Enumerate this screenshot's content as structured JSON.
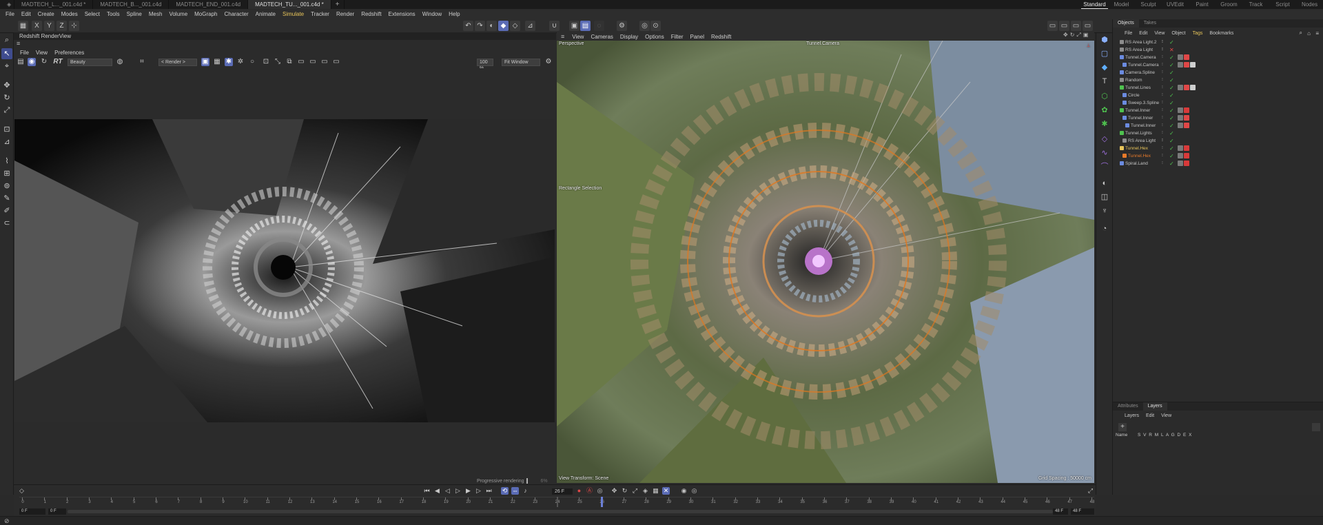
{
  "tabs": [
    "MADTECH_L..._001.c4d *",
    "MADTECH_B..._001.c4d",
    "MADTECH_END_001.c4d",
    "MADTECH_TU..._001.c4d *"
  ],
  "active_tab": 3,
  "new_tab": "+",
  "layouts": [
    "Standard",
    "Model",
    "Sculpt",
    "UVEdit",
    "Paint",
    "Groom",
    "Track",
    "Script",
    "Nodes"
  ],
  "menu": [
    "File",
    "Edit",
    "Create",
    "Modes",
    "Select",
    "Tools",
    "Spline",
    "Mesh",
    "Volume",
    "MoGraph",
    "Character",
    "Animate",
    "Simulate",
    "Tracker",
    "Render",
    "Redshift",
    "Extensions",
    "Window",
    "Help"
  ],
  "menu_highlight": "Simulate",
  "axis_labels": [
    "X",
    "Y",
    "Z"
  ],
  "renderview": {
    "title": "Redshift RenderView",
    "menu": [
      "File",
      "View",
      "Preferences"
    ],
    "rt": "RT",
    "aov": "Beauty",
    "render_target": "< Render >",
    "zoom": "100 %",
    "fit": "Fit Window",
    "progress_label": "Progressive rendering",
    "progress_pct": "6%"
  },
  "viewport": {
    "menu": [
      "View",
      "Cameras",
      "Display",
      "Options",
      "Filter",
      "Panel",
      "Redshift"
    ],
    "projection": "Perspective",
    "camera": "Tunnel.Camera",
    "selection": "Rectangle Selection",
    "view_transform": "View Transform: Scene",
    "grid_spacing": "Grid Spacing : 50000 cm"
  },
  "objects_panel": {
    "tabs": [
      "Objects",
      "Takes"
    ],
    "menu": [
      "File",
      "Edit",
      "View",
      "Object",
      "Tags",
      "Bookmarks"
    ],
    "items": [
      {
        "name": "RS Area Light.2",
        "indent": 1,
        "color": "#8c8c8c",
        "dot": "#e8e8e8",
        "status": "check",
        "highlight": false
      },
      {
        "name": "RS Area Light",
        "indent": 1,
        "color": "#8c8c8c",
        "dot": "#e8e8e8",
        "status": "cross",
        "highlight": false
      },
      {
        "name": "Tunnel.Camera",
        "indent": 1,
        "color": "#6b8be0",
        "dot": "#9c9c9c",
        "status": "check",
        "highlight": false
      },
      {
        "name": "Tunnel.Camera",
        "indent": 2,
        "color": "#6b8be0",
        "dot": "#9c9c9c",
        "status": "check",
        "highlight": false
      },
      {
        "name": "Camera.Spline",
        "indent": 1,
        "color": "#6b8be0",
        "dot": "#9c9c9c",
        "status": "check",
        "highlight": false
      },
      {
        "name": "Random",
        "indent": 1,
        "color": "#8c8c8c",
        "dot": "#9c9c9c",
        "status": "check",
        "highlight": false
      },
      {
        "name": "Tunnel.Lines",
        "indent": 1,
        "color": "#4fc24f",
        "dot": "#9c9c9c",
        "status": "check",
        "highlight": false
      },
      {
        "name": "Circle",
        "indent": 2,
        "color": "#6b8be0",
        "dot": "#9c9c9c",
        "status": "check",
        "highlight": false
      },
      {
        "name": "Sweep.3.Spline",
        "indent": 2,
        "color": "#6b8be0",
        "dot": "#9c9c9c",
        "status": "check",
        "highlight": false
      },
      {
        "name": "Tunnel.Inner",
        "indent": 1,
        "color": "#4fc24f",
        "dot": "#9c9c9c",
        "status": "check",
        "highlight": false
      },
      {
        "name": "Tunnel.Inner",
        "indent": 2,
        "color": "#6b8be0",
        "dot": "#9c9c9c",
        "status": "check",
        "highlight": false
      },
      {
        "name": "Tunnel.Inner",
        "indent": 3,
        "color": "#6b8be0",
        "dot": "#9c9c9c",
        "status": "check",
        "highlight": false
      },
      {
        "name": "Tunnel.Lights",
        "indent": 1,
        "color": "#4fc24f",
        "dot": "#9c9c9c",
        "status": "check",
        "highlight": false
      },
      {
        "name": "RS Area Light",
        "indent": 2,
        "color": "#8c8c8c",
        "dot": "#e8e8e8",
        "status": "check",
        "highlight": false
      },
      {
        "name": "Tunnel.Hex",
        "indent": 1,
        "color": "#e8c55a",
        "dot": "#9c9c9c",
        "status": "check",
        "highlight": true
      },
      {
        "name": "Tunnel.Hex",
        "indent": 2,
        "color": "#e87a2a",
        "dot": "#9c9c9c",
        "status": "check",
        "highlight": true
      },
      {
        "name": "Spiral.Land",
        "indent": 1,
        "color": "#6b8be0",
        "dot": "#9c9c9c",
        "status": "check",
        "highlight": false
      }
    ]
  },
  "attributes_panel": {
    "tabs": [
      "Attributes",
      "Layers"
    ],
    "active_tab": 1,
    "menu": [
      "Layers",
      "Edit",
      "View"
    ],
    "col_name": "Name",
    "col_flags": "S V R M L A G D E X"
  },
  "timeline": {
    "current_frame": "26 F",
    "ticks": [
      "0",
      "1",
      "2",
      "3",
      "4",
      "5",
      "6",
      "7",
      "8",
      "9",
      "10",
      "11",
      "12",
      "13",
      "14",
      "15",
      "16",
      "17",
      "18",
      "19",
      "20",
      "21",
      "22",
      "23",
      "24",
      "25",
      "26",
      "27",
      "28",
      "29",
      "30",
      "31",
      "32",
      "33",
      "34",
      "35",
      "36",
      "37",
      "38",
      "39",
      "40",
      "41",
      "42",
      "43",
      "44",
      "45",
      "46",
      "47",
      "48"
    ],
    "range_start": "0 F",
    "range_start2": "0 F",
    "range_end": "48 F",
    "range_end2": "48 F",
    "max_frame": 48,
    "playhead_frame": 26,
    "marker_frame": 24
  },
  "colors": {
    "accent": "#5a6bb5",
    "check": "#4fc24f",
    "highlight": "#e8c55a",
    "selection": "#e87a2a"
  },
  "icons": [
    "grid-icon",
    "undo-icon",
    "redo-icon",
    "move-icon",
    "rotate-icon",
    "scale-icon",
    "cube-icon",
    "spline-icon",
    "play-icon",
    "record-icon",
    "camera-icon",
    "light-icon"
  ]
}
